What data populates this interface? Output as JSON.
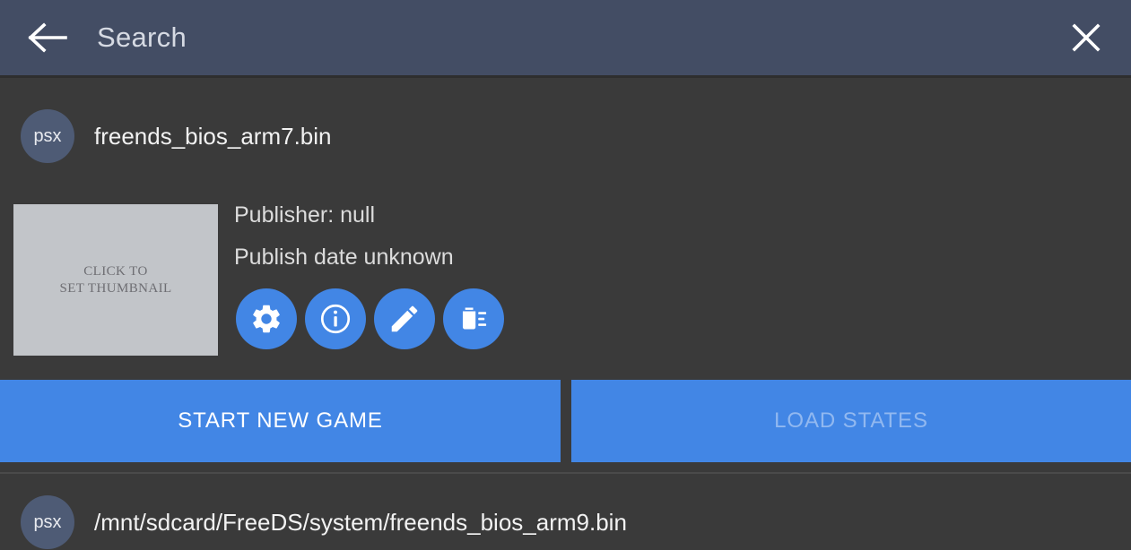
{
  "colors": {
    "header_bg": "#434d64",
    "page_bg": "#3a3a3a",
    "accent_blue": "#4286e5",
    "avatar_bg": "#4e5b75",
    "thumbnail_bg": "#c2c5c9",
    "primary_text": "#f2f2f2",
    "muted_text": "#dcdcdc",
    "disabled_label": "rgba(255,255,255,0.42)"
  },
  "header": {
    "title": "Search",
    "back_icon": "arrow-left-icon",
    "close_icon": "close-icon"
  },
  "results": {
    "top": {
      "badge": "psx",
      "label": "freends_bios_arm7.bin"
    },
    "bottom": {
      "badge": "psx",
      "label": "/mnt/sdcard/FreeDS/system/freends_bios_arm9.bin"
    }
  },
  "detail": {
    "thumbnail": {
      "line1": "CLICK TO",
      "line2": "SET THUMBNAIL"
    },
    "publisher": "Publisher: null",
    "publish_date": "Publish date unknown",
    "actions": [
      {
        "name": "settings",
        "icon": "gear-icon"
      },
      {
        "name": "info",
        "icon": "info-circle-icon"
      },
      {
        "name": "edit",
        "icon": "pencil-icon"
      },
      {
        "name": "delete",
        "icon": "trash-list-icon"
      }
    ]
  },
  "buttons": {
    "primary": "START NEW GAME",
    "secondary": "LOAD STATES"
  }
}
